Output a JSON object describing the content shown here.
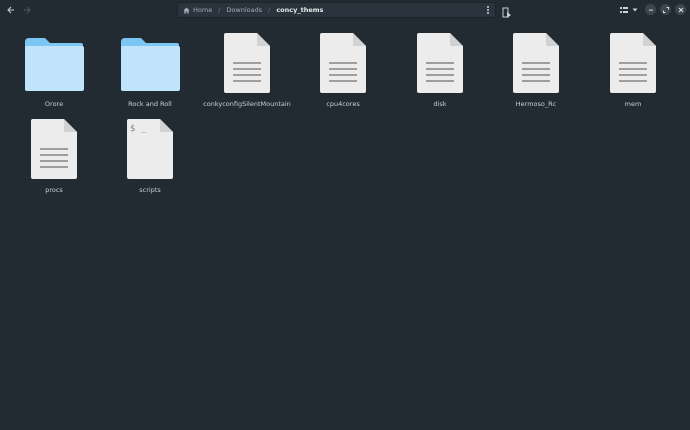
{
  "header": {
    "back_icon": "arrow-left-icon",
    "forward_icon": "arrow-right-icon",
    "breadcrumbs": [
      {
        "label": "Home",
        "icon": "home-icon"
      },
      {
        "label": "Downloads"
      },
      {
        "label": "concy_thems"
      }
    ],
    "separator": "/",
    "path_menu_icon": "vertical-dots-icon",
    "bookmark_icon": "bookmark-icon",
    "view_icon": "list-view-icon",
    "view_dropdown_icon": "chevron-down-icon",
    "minimize_icon": "minimize-icon",
    "maximize_icon": "maximize-icon",
    "close_icon": "close-icon"
  },
  "files": [
    {
      "name": "Orore",
      "type": "folder"
    },
    {
      "name": "Rock and Roll",
      "type": "folder"
    },
    {
      "name": "conkyconfigSilentMountain",
      "type": "text"
    },
    {
      "name": "cpu4cores",
      "type": "text"
    },
    {
      "name": "disk",
      "type": "text"
    },
    {
      "name": "Hermoso_Rc",
      "type": "text"
    },
    {
      "name": "mem",
      "type": "text"
    },
    {
      "name": "procs",
      "type": "text"
    },
    {
      "name": "scripts",
      "type": "script",
      "glyph": "$ _"
    }
  ],
  "colors": {
    "background": "#232b32",
    "folder_light": "#bfe4fb",
    "folder_tab": "#7cc6f4",
    "doc": "#ececec"
  }
}
